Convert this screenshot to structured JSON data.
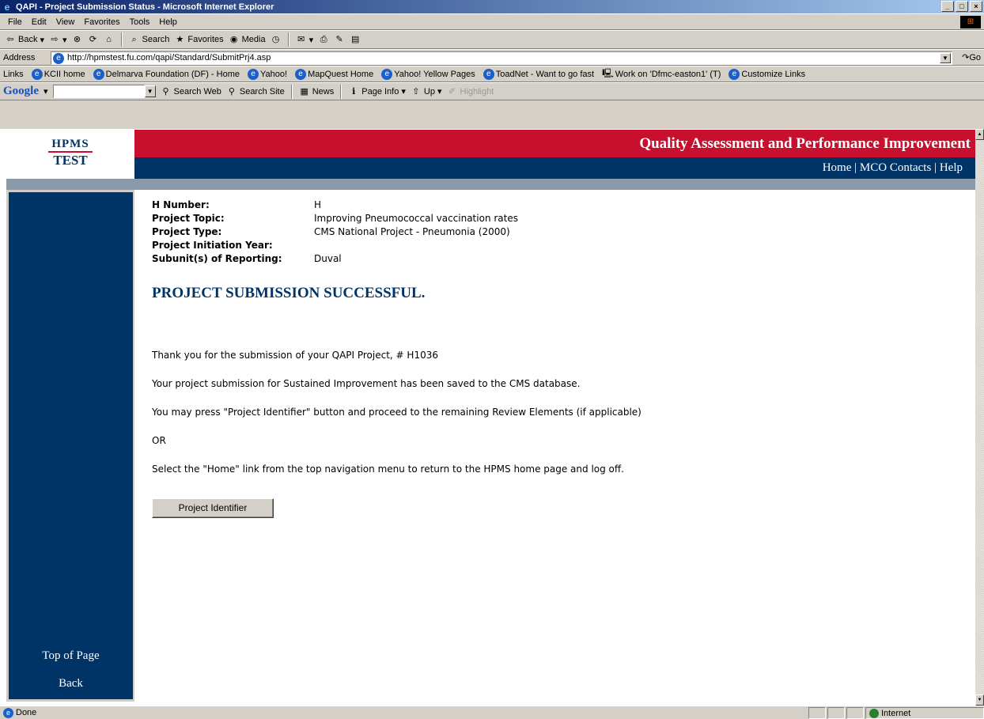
{
  "window": {
    "title": "QAPI - Project Submission Status - Microsoft Internet Explorer",
    "controls": [
      "_",
      "□",
      "×"
    ]
  },
  "menubar": [
    "File",
    "Edit",
    "View",
    "Favorites",
    "Tools",
    "Help"
  ],
  "toolbar": {
    "back": "Back",
    "search": "Search",
    "favorites": "Favorites",
    "media": "Media"
  },
  "address": {
    "label": "Address",
    "url": "http://hpmstest.fu.com/qapi/Standard/SubmitPrj4.asp",
    "go": "Go"
  },
  "links": {
    "label": "Links",
    "items": [
      "KCII home",
      "Delmarva Foundation (DF) - Home",
      "Yahoo!",
      "MapQuest Home",
      "Yahoo! Yellow Pages",
      "ToadNet - Want to go fast",
      "Work on 'Dfmc-easton1' (T)",
      "Customize Links"
    ]
  },
  "google": {
    "logo": "Google",
    "search_web": "Search Web",
    "search_site": "Search Site",
    "news": "News",
    "page_info": "Page Info",
    "up": "Up",
    "highlight": "Highlight"
  },
  "site": {
    "logo_line1": "HPMS",
    "logo_line2": "TEST",
    "app_title": "Quality Assessment and Performance Improvement",
    "nav": [
      "Home",
      "MCO Contacts",
      "Help"
    ],
    "side": [
      "Top of Page",
      "Back"
    ]
  },
  "project": {
    "fields": [
      {
        "label": "H Number:",
        "value": "H"
      },
      {
        "label": "Project Topic:",
        "value": "Improving Pneumococcal vaccination rates"
      },
      {
        "label": "Project Type:",
        "value": "CMS National Project - Pneumonia (2000)"
      },
      {
        "label": "Project Initiation Year:",
        "value": ""
      },
      {
        "label": "Subunit(s) of Reporting:",
        "value": "Duval"
      }
    ],
    "heading": "PROJECT SUBMISSION SUCCESSFUL.",
    "messages": [
      "Thank you for the submission of your QAPI Project, # H1036",
      "Your project submission for Sustained Improvement has been saved to the CMS database.",
      "You may press \"Project Identifier\" button and proceed to the remaining Review Elements (if applicable)",
      "OR",
      "Select the \"Home\" link from the top navigation menu to return to the HPMS home page and log off."
    ],
    "button": "Project Identifier"
  },
  "status": {
    "text": "Done",
    "zone": "Internet"
  }
}
